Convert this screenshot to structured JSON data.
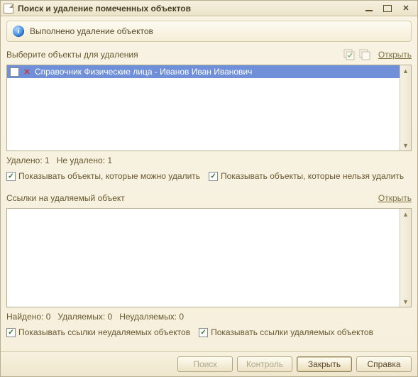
{
  "window": {
    "title": "Поиск и удаление помеченных объектов"
  },
  "notice": {
    "text": "Выполнено удаление объектов"
  },
  "upper": {
    "label": "Выберите объекты для удаления",
    "open_link": "Открыть",
    "items": [
      {
        "checked": false,
        "marked_for_delete": true,
        "text": "Справочник Физические лица - Иванов Иван Иванович"
      }
    ],
    "status": {
      "deleted_label": "Удалено:",
      "deleted_count": "1",
      "not_deleted_label": "Не удалено:",
      "not_deleted_count": "1"
    },
    "filters": {
      "show_deletable": {
        "checked": true,
        "label": "Показывать объекты, которые можно удалить"
      },
      "show_undeletable": {
        "checked": true,
        "label": "Показывать объекты, которые нельзя удалить"
      }
    }
  },
  "refs": {
    "label": "Ссылки на удаляемый объект",
    "open_link": "Открыть",
    "status": {
      "found_label": "Найдено:",
      "found_count": "0",
      "deletable_label": "Удаляемых:",
      "deletable_count": "0",
      "undeletable_label": "Неудаляемых:",
      "undeletable_count": "0"
    },
    "filters": {
      "show_undeletable_refs": {
        "checked": true,
        "label": "Показывать ссылки неудаляемых объектов"
      },
      "show_deletable_refs": {
        "checked": true,
        "label": "Показывать ссылки удаляемых объектов"
      }
    }
  },
  "buttons": {
    "search": "Поиск",
    "control": "Контроль",
    "close": "Закрыть",
    "help": "Справка"
  }
}
